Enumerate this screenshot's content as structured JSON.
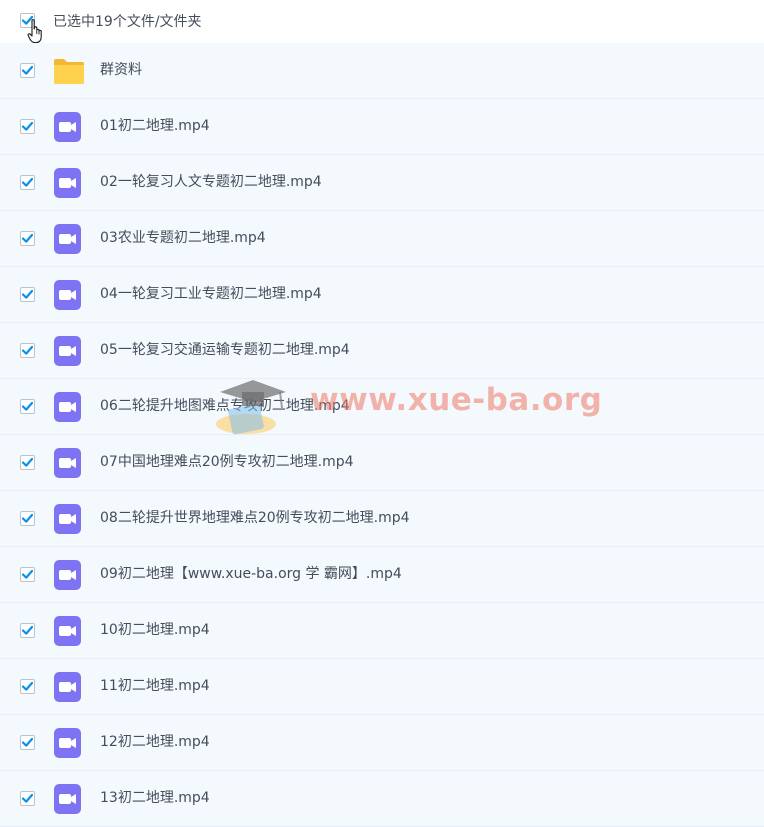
{
  "header": {
    "select_all_checked": true,
    "selection_label": "已选中19个文件/文件夹"
  },
  "files": [
    {
      "name": "群资料",
      "type": "folder",
      "checked": true
    },
    {
      "name": "01初二地理.mp4",
      "type": "video",
      "checked": true
    },
    {
      "name": "02一轮复习人文专题初二地理.mp4",
      "type": "video",
      "checked": true
    },
    {
      "name": "03农业专题初二地理.mp4",
      "type": "video",
      "checked": true
    },
    {
      "name": "04一轮复习工业专题初二地理.mp4",
      "type": "video",
      "checked": true
    },
    {
      "name": "05一轮复习交通运输专题初二地理.mp4",
      "type": "video",
      "checked": true
    },
    {
      "name": "06二轮提升地图难点专攻初二地理.mp4",
      "type": "video",
      "checked": true
    },
    {
      "name": "07中国地理难点20例专攻初二地理.mp4",
      "type": "video",
      "checked": true
    },
    {
      "name": "08二轮提升世界地理难点20例专攻初二地理.mp4",
      "type": "video",
      "checked": true
    },
    {
      "name": "09初二地理【www.xue-ba.org 学 霸网】.mp4",
      "type": "video",
      "checked": true
    },
    {
      "name": "10初二地理.mp4",
      "type": "video",
      "checked": true
    },
    {
      "name": "11初二地理.mp4",
      "type": "video",
      "checked": true
    },
    {
      "name": "12初二地理.mp4",
      "type": "video",
      "checked": true
    },
    {
      "name": "13初二地理.mp4",
      "type": "video",
      "checked": true
    }
  ],
  "watermark": {
    "text": "www.xue-ba.org"
  },
  "colors": {
    "check": "#0a8fe6",
    "video_icon": "#7e73f2",
    "folder": "#ffd24d",
    "row_bg": "#f4f9fe"
  }
}
